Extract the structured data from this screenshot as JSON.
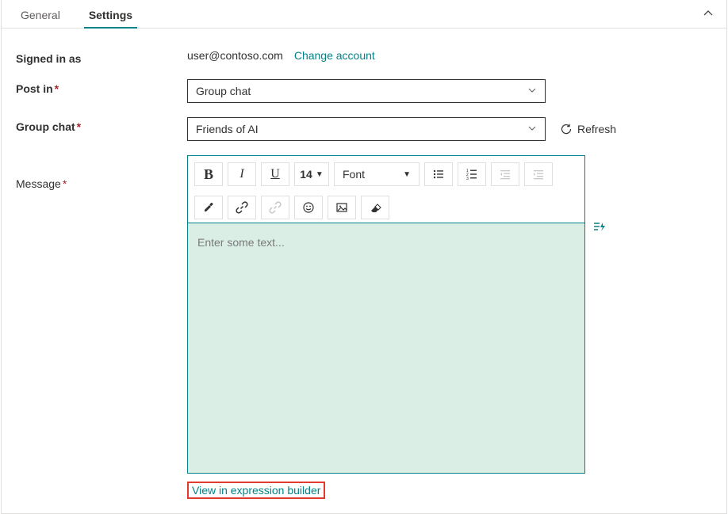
{
  "tabs": {
    "general": "General",
    "settings": "Settings"
  },
  "signedIn": {
    "label": "Signed in as",
    "email": "user@contoso.com",
    "changeLink": "Change account"
  },
  "postIn": {
    "label": "Post in",
    "value": "Group chat"
  },
  "groupChat": {
    "label": "Group chat",
    "value": "Friends of AI",
    "refresh": "Refresh"
  },
  "message": {
    "label": "Message",
    "placeholder": "Enter some text...",
    "fontSize": "14",
    "fontName": "Font",
    "exprLink": "View in expression builder"
  }
}
